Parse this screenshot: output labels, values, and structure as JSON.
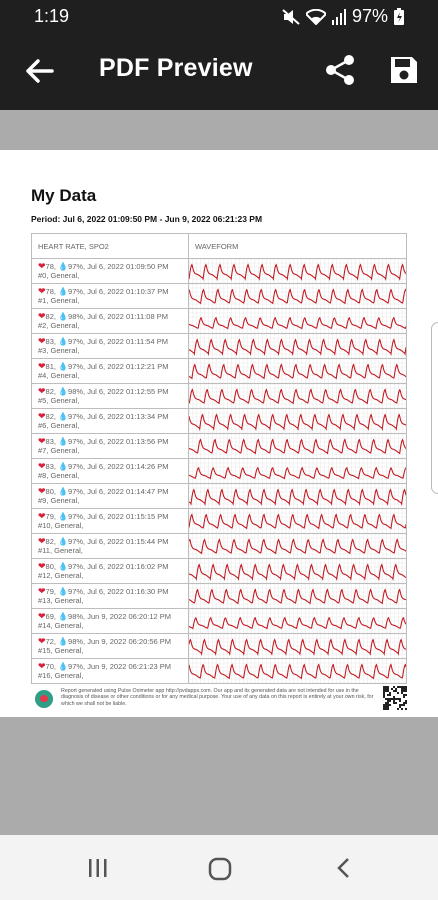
{
  "status_bar": {
    "time": "1:19",
    "battery": "97%"
  },
  "app_bar": {
    "title": "PDF Preview"
  },
  "document": {
    "title": "My Data",
    "period": "Period: Jul 6, 2022 01:09:50 PM - Jun 9, 2022 06:21:23 PM",
    "columns": [
      "HEART RATE, SPO2",
      "WAVEFORM"
    ],
    "rows": [
      {
        "hr": "78",
        "spo2": "97%",
        "time": "Jul 6, 2022 01:09:50 PM",
        "id": "#0, General,"
      },
      {
        "hr": "78",
        "spo2": "97%",
        "time": "Jul 6, 2022 01:10:37 PM",
        "id": "#1, General,"
      },
      {
        "hr": "82",
        "spo2": "98%",
        "time": "Jul 6, 2022 01:11:08 PM",
        "id": "#2, General,"
      },
      {
        "hr": "83",
        "spo2": "97%",
        "time": "Jul 6, 2022 01:11:54 PM",
        "id": "#3, General,"
      },
      {
        "hr": "81",
        "spo2": "97%",
        "time": "Jul 6, 2022 01:12:21 PM",
        "id": "#4, General,"
      },
      {
        "hr": "82",
        "spo2": "98%",
        "time": "Jul 6, 2022 01:12:55 PM",
        "id": "#5, General,"
      },
      {
        "hr": "82",
        "spo2": "97%",
        "time": "Jul 6, 2022 01:13:34 PM",
        "id": "#6, General,"
      },
      {
        "hr": "83",
        "spo2": "97%",
        "time": "Jul 6, 2022 01:13:56 PM",
        "id": "#7, General,"
      },
      {
        "hr": "83",
        "spo2": "97%",
        "time": "Jul 6, 2022 01:14:26 PM",
        "id": "#8, General,"
      },
      {
        "hr": "80",
        "spo2": "97%",
        "time": "Jul 6, 2022 01:14:47 PM",
        "id": "#9, General,"
      },
      {
        "hr": "79",
        "spo2": "97%",
        "time": "Jul 6, 2022 01:15:15 PM",
        "id": "#10, General,"
      },
      {
        "hr": "82",
        "spo2": "97%",
        "time": "Jul 6, 2022 01:15:44 PM",
        "id": "#11, General,"
      },
      {
        "hr": "80",
        "spo2": "97%",
        "time": "Jul 6, 2022 01:16:02 PM",
        "id": "#12, General,"
      },
      {
        "hr": "79",
        "spo2": "97%",
        "time": "Jul 6, 2022 01:16:30 PM",
        "id": "#13, General,"
      },
      {
        "hr": "69",
        "spo2": "98%",
        "time": "Jun 9, 2022 06:20:12 PM",
        "id": "#14, General,"
      },
      {
        "hr": "72",
        "spo2": "98%",
        "time": "Jun 9, 2022 06:20:56 PM",
        "id": "#15, General,"
      },
      {
        "hr": "70",
        "spo2": "97%",
        "time": "Jun 9, 2022 06:21:23 PM",
        "id": "#16, General,"
      }
    ],
    "footer": "Report generated using Pulse Oximeter app http://pvdapps.com. Our app and its generated data are not intended for use in the diagnosis of disease or other conditions or for any medical purpose. Your use of any data on this report is entirely at your own risk, for which we shall not be liable."
  },
  "colors": {
    "app_bar": "#1f1f1f",
    "waveform": "#c2181f",
    "heart": "#d8203a",
    "drop": "#3a9ad9"
  },
  "icons": [
    "back-arrow-icon",
    "share-icon",
    "save-icon",
    "heart-icon",
    "drop-icon"
  ]
}
